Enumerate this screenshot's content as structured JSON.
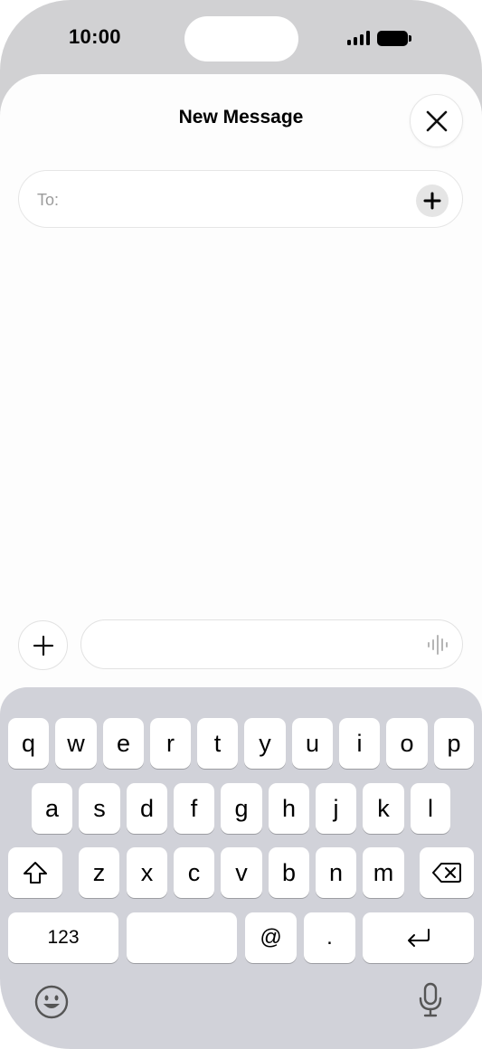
{
  "status_bar": {
    "time": "10:00",
    "signal_icon": "cellular-signal-icon",
    "battery_icon": "battery-icon"
  },
  "header": {
    "title": "New Message",
    "close_icon": "close-icon"
  },
  "recipient": {
    "label": "To:",
    "add_icon": "plus-icon"
  },
  "composer": {
    "attach_icon": "plus-icon",
    "message_placeholder": "",
    "voice_icon": "waveform-icon"
  },
  "keyboard": {
    "row1": [
      "q",
      "w",
      "e",
      "r",
      "t",
      "y",
      "u",
      "i",
      "o",
      "p"
    ],
    "row2": [
      "a",
      "s",
      "d",
      "f",
      "g",
      "h",
      "j",
      "k",
      "l"
    ],
    "row3": [
      "z",
      "x",
      "c",
      "v",
      "b",
      "n",
      "m"
    ],
    "shift_icon": "shift-arrow-icon",
    "delete_icon": "delete-backspace-icon",
    "numbers_label": "123",
    "at_label": "@",
    "period_label": ".",
    "return_icon": "return-icon",
    "emoji_icon": "emoji-face-icon",
    "dictation_icon": "microphone-icon"
  }
}
